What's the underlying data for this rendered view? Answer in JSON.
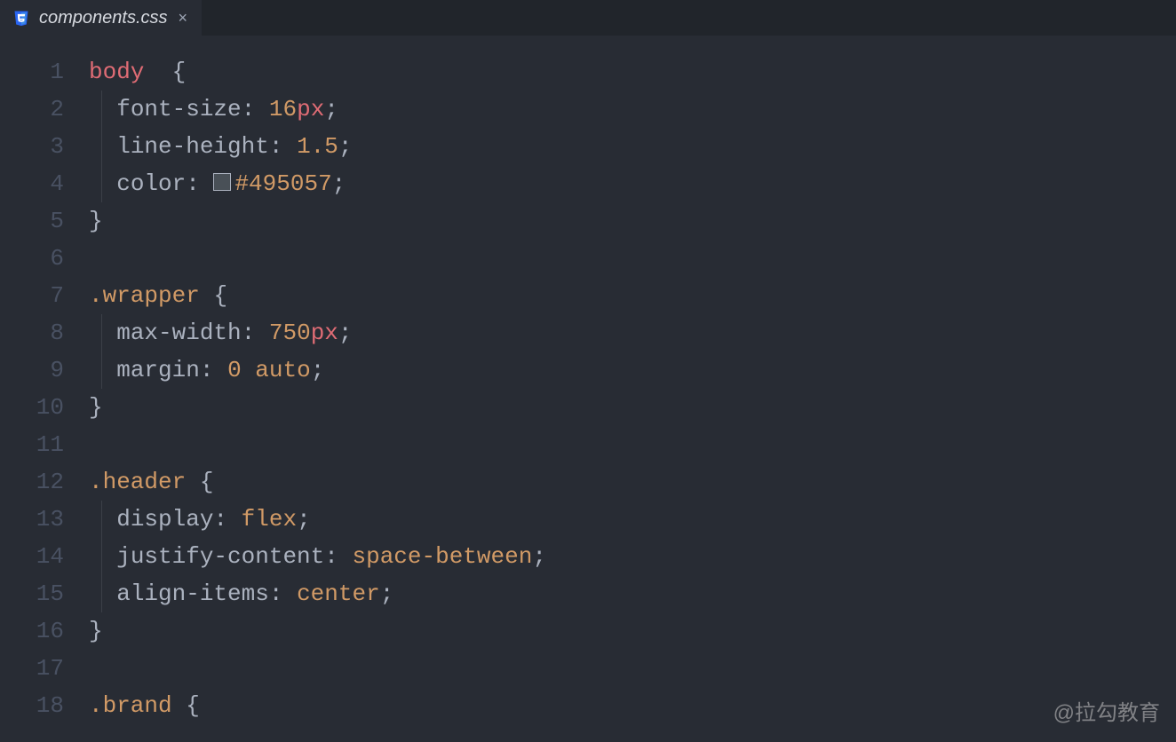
{
  "tab": {
    "filename": "components.css",
    "icon": "css-file-icon",
    "close": "×"
  },
  "watermark": "@拉勾教育",
  "gutter": {
    "start": 1,
    "end": 18
  },
  "colors": {
    "swatch1": "#495057"
  },
  "code": [
    {
      "indent": 0,
      "tokens": [
        {
          "t": "selector-tag",
          "v": "body"
        },
        {
          "t": "space",
          "v": "  "
        },
        {
          "t": "brace",
          "v": "{"
        }
      ]
    },
    {
      "indent": 1,
      "tokens": [
        {
          "t": "property",
          "v": "font-size"
        },
        {
          "t": "colon",
          "v": ": "
        },
        {
          "t": "number",
          "v": "16"
        },
        {
          "t": "unit",
          "v": "px"
        },
        {
          "t": "semi",
          "v": ";"
        }
      ]
    },
    {
      "indent": 1,
      "tokens": [
        {
          "t": "property",
          "v": "line-height"
        },
        {
          "t": "colon",
          "v": ": "
        },
        {
          "t": "number",
          "v": "1.5"
        },
        {
          "t": "semi",
          "v": ";"
        }
      ]
    },
    {
      "indent": 1,
      "tokens": [
        {
          "t": "property",
          "v": "color"
        },
        {
          "t": "colon",
          "v": ": "
        },
        {
          "t": "swatch",
          "v": "#495057"
        },
        {
          "t": "value",
          "v": "#495057"
        },
        {
          "t": "semi",
          "v": ";"
        }
      ]
    },
    {
      "indent": 0,
      "tokens": [
        {
          "t": "brace",
          "v": "}"
        }
      ]
    },
    {
      "indent": 0,
      "tokens": []
    },
    {
      "indent": 0,
      "tokens": [
        {
          "t": "selector-class",
          "v": ".wrapper"
        },
        {
          "t": "space",
          "v": " "
        },
        {
          "t": "brace",
          "v": "{"
        }
      ]
    },
    {
      "indent": 1,
      "tokens": [
        {
          "t": "property",
          "v": "max-width"
        },
        {
          "t": "colon",
          "v": ": "
        },
        {
          "t": "number",
          "v": "750"
        },
        {
          "t": "unit",
          "v": "px"
        },
        {
          "t": "semi",
          "v": ";"
        }
      ]
    },
    {
      "indent": 1,
      "tokens": [
        {
          "t": "property",
          "v": "margin"
        },
        {
          "t": "colon",
          "v": ": "
        },
        {
          "t": "number",
          "v": "0"
        },
        {
          "t": "space",
          "v": " "
        },
        {
          "t": "value",
          "v": "auto"
        },
        {
          "t": "semi",
          "v": ";"
        }
      ]
    },
    {
      "indent": 0,
      "tokens": [
        {
          "t": "brace",
          "v": "}"
        }
      ]
    },
    {
      "indent": 0,
      "tokens": []
    },
    {
      "indent": 0,
      "tokens": [
        {
          "t": "selector-class",
          "v": ".header"
        },
        {
          "t": "space",
          "v": " "
        },
        {
          "t": "brace",
          "v": "{"
        }
      ]
    },
    {
      "indent": 1,
      "tokens": [
        {
          "t": "property",
          "v": "display"
        },
        {
          "t": "colon",
          "v": ": "
        },
        {
          "t": "value",
          "v": "flex"
        },
        {
          "t": "semi",
          "v": ";"
        }
      ]
    },
    {
      "indent": 1,
      "tokens": [
        {
          "t": "property",
          "v": "justify-content"
        },
        {
          "t": "colon",
          "v": ": "
        },
        {
          "t": "value",
          "v": "space-between"
        },
        {
          "t": "semi",
          "v": ";"
        }
      ]
    },
    {
      "indent": 1,
      "tokens": [
        {
          "t": "property",
          "v": "align-items"
        },
        {
          "t": "colon",
          "v": ": "
        },
        {
          "t": "value",
          "v": "center"
        },
        {
          "t": "semi",
          "v": ";"
        }
      ]
    },
    {
      "indent": 0,
      "tokens": [
        {
          "t": "brace",
          "v": "}"
        }
      ]
    },
    {
      "indent": 0,
      "tokens": []
    },
    {
      "indent": 0,
      "tokens": [
        {
          "t": "selector-class",
          "v": ".brand"
        },
        {
          "t": "space",
          "v": " "
        },
        {
          "t": "brace",
          "v": "{"
        }
      ]
    }
  ],
  "guides": [
    {
      "start": 2,
      "end": 4
    },
    {
      "start": 8,
      "end": 9
    },
    {
      "start": 13,
      "end": 15
    }
  ]
}
